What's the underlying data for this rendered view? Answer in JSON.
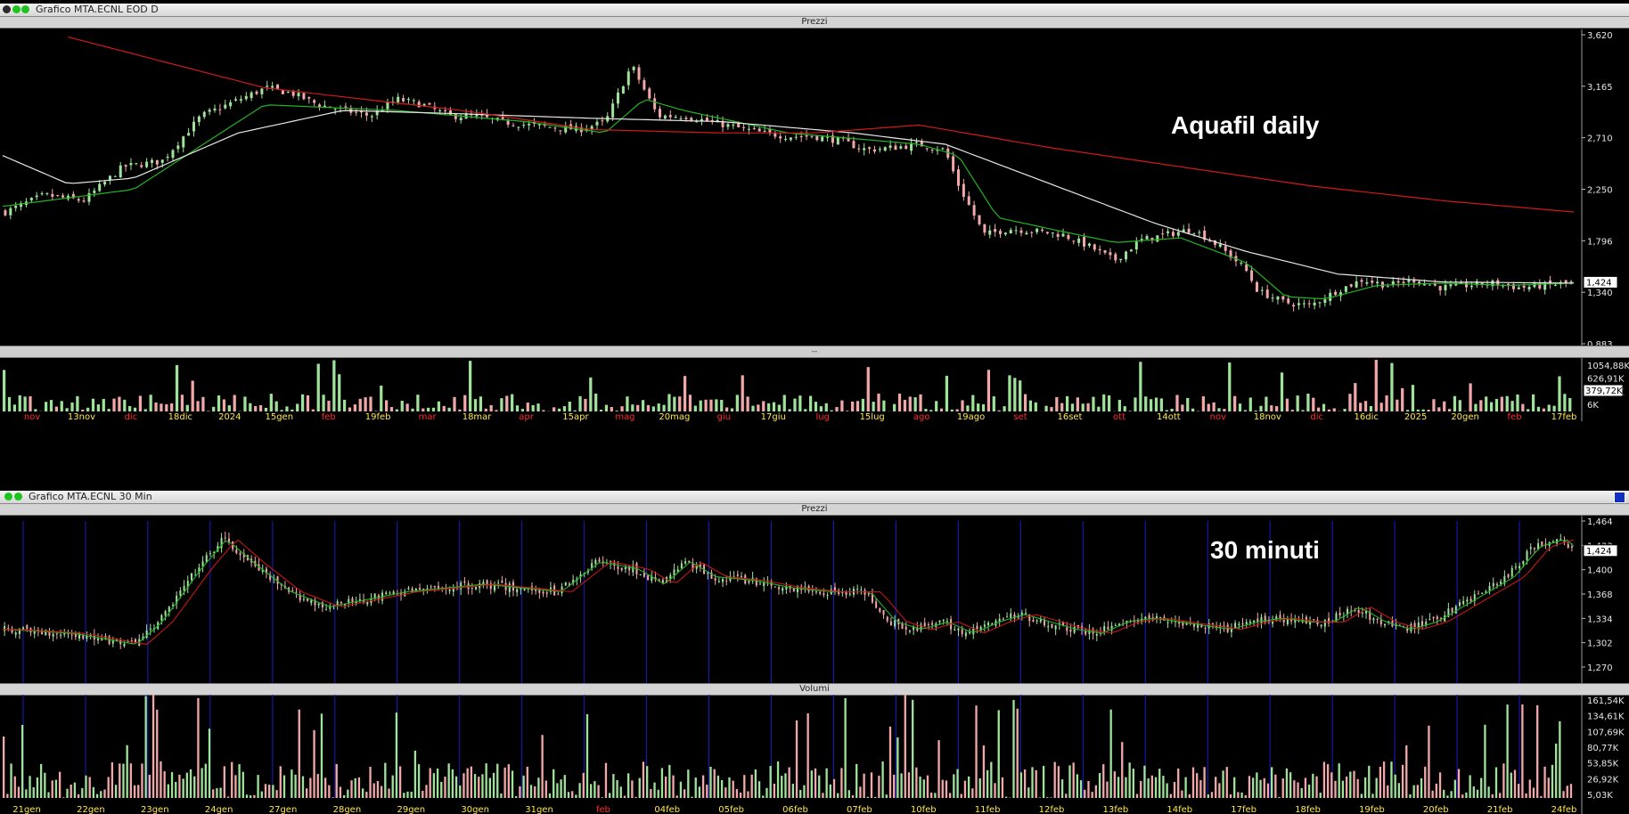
{
  "window_top": {
    "title": "Grafico MTA.ECNL EOD D",
    "panel_price_title": "Prezzi",
    "panel_volume_title": "--",
    "overlay_text": "Aquafil daily"
  },
  "window_bottom": {
    "title": "Grafico MTA.ECNL 30 Min",
    "panel_price_title": "Prezzi",
    "panel_volume_title": "Volumi",
    "overlay_text": "30 minuti"
  },
  "colors": {
    "up": "#9fe39a",
    "down": "#f2a8a8",
    "ma_fast": "#22b322",
    "ma_mid": "#e8e8e8",
    "ma_slow": "#d21a1a",
    "session_line": "#1b1bc8",
    "last_price_box": "#ffffff"
  },
  "chart_data": [
    {
      "name": "daily_price",
      "type": "candlestick",
      "ylim": [
        0.883,
        3.62
      ],
      "y_ticks": [
        "3,620",
        "3,165",
        "2,710",
        "2,250",
        "1,796",
        "1,340",
        "0,883"
      ],
      "last_price_label": "1,424",
      "series": [
        {
          "name": "close",
          "points": [
            [
              0,
              2.05
            ],
            [
              3,
              2.2
            ],
            [
              6,
              2.15
            ],
            [
              9,
              2.45
            ],
            [
              12,
              2.5
            ],
            [
              15,
              2.9
            ],
            [
              18,
              3.05
            ],
            [
              20,
              3.15
            ],
            [
              22,
              3.1
            ],
            [
              24,
              3.0
            ],
            [
              26,
              2.95
            ],
            [
              28,
              2.9
            ],
            [
              30,
              3.05
            ],
            [
              32,
              3.0
            ],
            [
              34,
              2.9
            ],
            [
              36,
              2.9
            ],
            [
              38,
              2.85
            ],
            [
              40,
              2.82
            ],
            [
              42,
              2.8
            ],
            [
              44,
              2.78
            ],
            [
              46,
              2.85
            ],
            [
              48,
              3.35
            ],
            [
              50,
              2.9
            ],
            [
              52,
              2.9
            ],
            [
              54,
              2.85
            ],
            [
              56,
              2.8
            ],
            [
              58,
              2.75
            ],
            [
              60,
              2.72
            ],
            [
              62,
              2.72
            ],
            [
              64,
              2.68
            ],
            [
              66,
              2.6
            ],
            [
              68,
              2.62
            ],
            [
              70,
              2.65
            ],
            [
              72,
              2.6
            ],
            [
              73,
              2.3
            ],
            [
              75,
              1.85
            ],
            [
              77,
              1.9
            ],
            [
              79,
              1.88
            ],
            [
              81,
              1.85
            ],
            [
              83,
              1.75
            ],
            [
              85,
              1.62
            ],
            [
              87,
              1.8
            ],
            [
              89,
              1.85
            ],
            [
              91,
              1.9
            ],
            [
              93,
              1.75
            ],
            [
              95,
              1.55
            ],
            [
              96,
              1.35
            ],
            [
              98,
              1.25
            ],
            [
              100,
              1.22
            ],
            [
              102,
              1.35
            ],
            [
              104,
              1.45
            ],
            [
              106,
              1.4
            ],
            [
              108,
              1.45
            ],
            [
              110,
              1.38
            ],
            [
              112,
              1.4
            ],
            [
              114,
              1.42
            ],
            [
              116,
              1.38
            ],
            [
              118,
              1.4
            ],
            [
              120,
              1.424
            ]
          ]
        },
        {
          "name": "ma_fast",
          "points": [
            [
              0,
              2.1
            ],
            [
              10,
              2.25
            ],
            [
              20,
              3.0
            ],
            [
              30,
              2.95
            ],
            [
              40,
              2.85
            ],
            [
              46,
              2.75
            ],
            [
              49,
              3.05
            ],
            [
              52,
              2.95
            ],
            [
              60,
              2.75
            ],
            [
              70,
              2.65
            ],
            [
              73,
              2.55
            ],
            [
              76,
              2.0
            ],
            [
              80,
              1.9
            ],
            [
              85,
              1.78
            ],
            [
              90,
              1.82
            ],
            [
              95,
              1.6
            ],
            [
              98,
              1.3
            ],
            [
              101,
              1.28
            ],
            [
              105,
              1.4
            ],
            [
              110,
              1.42
            ],
            [
              115,
              1.4
            ],
            [
              120,
              1.42
            ]
          ]
        },
        {
          "name": "ma_mid",
          "points": [
            [
              0,
              2.55
            ],
            [
              5,
              2.3
            ],
            [
              10,
              2.35
            ],
            [
              18,
              2.75
            ],
            [
              26,
              2.95
            ],
            [
              35,
              2.92
            ],
            [
              45,
              2.88
            ],
            [
              55,
              2.85
            ],
            [
              65,
              2.75
            ],
            [
              72,
              2.65
            ],
            [
              80,
              2.3
            ],
            [
              88,
              1.95
            ],
            [
              95,
              1.7
            ],
            [
              102,
              1.5
            ],
            [
              110,
              1.43
            ],
            [
              120,
              1.42
            ]
          ]
        },
        {
          "name": "ma_slow",
          "points": [
            [
              5,
              3.6
            ],
            [
              20,
              3.15
            ],
            [
              35,
              2.95
            ],
            [
              45,
              2.78
            ],
            [
              55,
              2.75
            ],
            [
              62,
              2.75
            ],
            [
              70,
              2.82
            ],
            [
              80,
              2.62
            ],
            [
              90,
              2.45
            ],
            [
              100,
              2.28
            ],
            [
              110,
              2.15
            ],
            [
              120,
              2.05
            ]
          ]
        }
      ]
    },
    {
      "name": "daily_volume",
      "type": "bar",
      "y_ticks": [
        "1054,88K",
        "626,91K",
        "379,72K",
        "6K"
      ],
      "last_volume_label": "379,72K",
      "x_tick_labels": [
        "nov",
        "13nov",
        "dic",
        "18dic",
        "2024",
        "15gen",
        "feb",
        "19feb",
        "mar",
        "18mar",
        "apr",
        "15apr",
        "mag",
        "20mag",
        "giu",
        "17giu",
        "lug",
        "15lug",
        "ago",
        "19ago",
        "set",
        "16set",
        "ott",
        "14ott",
        "nov",
        "18nov",
        "dic",
        "16dic",
        "2025",
        "20gen",
        "feb",
        "17feb"
      ],
      "month_labels_red": [
        "nov",
        "dic",
        "feb",
        "mar",
        "apr",
        "mag",
        "giu",
        "lug",
        "ago",
        "set",
        "ott",
        "nov",
        "dic",
        "feb"
      ]
    },
    {
      "name": "intraday_30min_price",
      "type": "candlestick",
      "ylim": [
        1.27,
        1.464
      ],
      "y_ticks": [
        "1,464",
        "1,433",
        "1,400",
        "1,368",
        "1,334",
        "1,302",
        "1,270"
      ],
      "last_price_label": "1,424",
      "series": [
        {
          "name": "close",
          "points": [
            [
              0,
              1.32
            ],
            [
              5,
              1.315
            ],
            [
              10,
              1.3
            ],
            [
              12,
              1.33
            ],
            [
              15,
              1.4
            ],
            [
              17,
              1.44
            ],
            [
              19,
              1.41
            ],
            [
              22,
              1.37
            ],
            [
              25,
              1.35
            ],
            [
              28,
              1.36
            ],
            [
              31,
              1.37
            ],
            [
              34,
              1.375
            ],
            [
              37,
              1.38
            ],
            [
              40,
              1.375
            ],
            [
              43,
              1.37
            ],
            [
              46,
              1.41
            ],
            [
              49,
              1.4
            ],
            [
              51,
              1.38
            ],
            [
              53,
              1.41
            ],
            [
              55,
              1.39
            ],
            [
              58,
              1.385
            ],
            [
              61,
              1.375
            ],
            [
              64,
              1.37
            ],
            [
              67,
              1.37
            ],
            [
              69,
              1.33
            ],
            [
              71,
              1.32
            ],
            [
              73,
              1.33
            ],
            [
              75,
              1.315
            ],
            [
              77,
              1.33
            ],
            [
              79,
              1.34
            ],
            [
              81,
              1.33
            ],
            [
              83,
              1.32
            ],
            [
              85,
              1.315
            ],
            [
              87,
              1.33
            ],
            [
              89,
              1.335
            ],
            [
              91,
              1.33
            ],
            [
              93,
              1.325
            ],
            [
              95,
              1.32
            ],
            [
              97,
              1.33
            ],
            [
              99,
              1.335
            ],
            [
              101,
              1.33
            ],
            [
              103,
              1.33
            ],
            [
              105,
              1.35
            ],
            [
              107,
              1.33
            ],
            [
              109,
              1.32
            ],
            [
              111,
              1.33
            ],
            [
              113,
              1.35
            ],
            [
              115,
              1.37
            ],
            [
              117,
              1.39
            ],
            [
              119,
              1.43
            ],
            [
              121,
              1.44
            ],
            [
              122,
              1.424
            ]
          ]
        }
      ]
    },
    {
      "name": "intraday_30min_volume",
      "type": "bar",
      "y_ticks": [
        "161,54K",
        "134,61K",
        "107,69K",
        "80,77K",
        "53,85K",
        "26,92K",
        "5,03K"
      ],
      "x_tick_labels": [
        "21gen",
        "22gen",
        "23gen",
        "24gen",
        "27gen",
        "28gen",
        "29gen",
        "30gen",
        "31gen",
        "feb",
        "04feb",
        "05feb",
        "06feb",
        "07feb",
        "10feb",
        "11feb",
        "12feb",
        "13feb",
        "14feb",
        "17feb",
        "18feb",
        "19feb",
        "20feb",
        "21feb",
        "24feb"
      ],
      "red_labels": [
        "feb"
      ]
    }
  ]
}
